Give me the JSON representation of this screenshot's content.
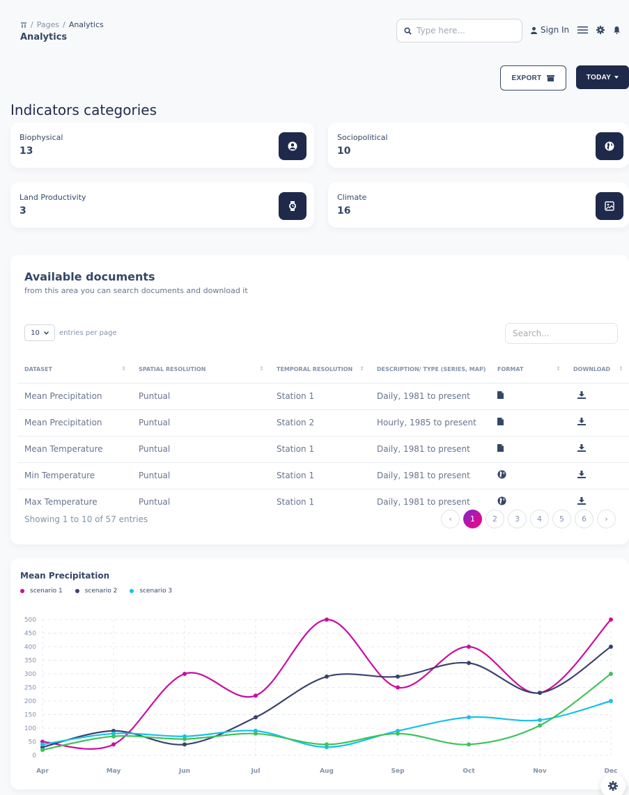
{
  "breadcrumb": {
    "sep": "/",
    "pages": "Pages",
    "current": "Analytics"
  },
  "page_title": "Analytics",
  "search": {
    "placeholder": "Type here..."
  },
  "nav": {
    "signin": "Sign In"
  },
  "buttons": {
    "export": "EXPORT",
    "today": "TODAY"
  },
  "categories_title": "Indicators categories",
  "categories": [
    {
      "label": "Biophysical",
      "value": "13",
      "icon": "user-circle-icon"
    },
    {
      "label": "Sociopolitical",
      "value": "10",
      "icon": "globe-icon"
    },
    {
      "label": "Land Productivity",
      "value": "3",
      "icon": "watch-icon"
    },
    {
      "label": "Climate",
      "value": "16",
      "icon": "image-icon"
    }
  ],
  "documents": {
    "title": "Available documents",
    "subtitle": "from this area you can search documents and download it",
    "entries_value": "10",
    "entries_label": "entries per page",
    "search_placeholder": "Search...",
    "columns": [
      "DATASET",
      "SPATIAL RESOLUTION",
      "TEMPORAL RESOLUTION",
      "DESCRIPTION/ TYPE (SERIES, MAP)",
      "FORMAT",
      "DOWNLOAD"
    ],
    "rows": [
      {
        "dataset": "Mean Precipitation",
        "spatial": "Puntual",
        "temporal": "Station 1",
        "desc": "Daily, 1981 to present",
        "format": "file-icon"
      },
      {
        "dataset": "Mean Precipitation",
        "spatial": "Puntual",
        "temporal": "Station 2",
        "desc": "Hourly, 1985 to present",
        "format": "file-icon"
      },
      {
        "dataset": "Mean Temperature",
        "spatial": "Puntual",
        "temporal": "Station 1",
        "desc": "Daily, 1981 to present",
        "format": "file-icon"
      },
      {
        "dataset": "Min Temperature",
        "spatial": "Puntual",
        "temporal": "Station 1",
        "desc": "Daily, 1981 to present",
        "format": "globe-icon"
      },
      {
        "dataset": "Max Temperature",
        "spatial": "Puntual",
        "temporal": "Station 1",
        "desc": "Daily, 1981 to present",
        "format": "globe-icon"
      }
    ],
    "showing": "Showing 1 to 10 of 57 entries",
    "pages": [
      "‹",
      "1",
      "2",
      "3",
      "4",
      "5",
      "6",
      "›"
    ],
    "active_page": "1"
  },
  "chart_data": {
    "type": "line",
    "title": "Mean Precipitation",
    "categories": [
      "Apr",
      "May",
      "Jun",
      "Jul",
      "Aug",
      "Sep",
      "Oct",
      "Nov",
      "Dec"
    ],
    "yticks": [
      0,
      50,
      100,
      150,
      200,
      250,
      300,
      350,
      400,
      450,
      500
    ],
    "ylim": [
      0,
      500
    ],
    "grid": true,
    "legend_position": "top-left",
    "series": [
      {
        "name": "scenario 1",
        "color": "#cb0c9f",
        "values": [
          50,
          40,
          300,
          220,
          500,
          250,
          400,
          230,
          500
        ]
      },
      {
        "name": "scenario 2",
        "color": "#3a416f",
        "values": [
          30,
          90,
          40,
          140,
          290,
          290,
          340,
          230,
          400
        ]
      },
      {
        "name": "scenario 3",
        "color": "#17c1e8",
        "values": [
          40,
          80,
          70,
          90,
          30,
          90,
          140,
          130,
          200
        ]
      },
      {
        "name": "",
        "color": "#3dc35b",
        "values": [
          20,
          70,
          60,
          80,
          40,
          80,
          40,
          110,
          300
        ]
      }
    ]
  }
}
